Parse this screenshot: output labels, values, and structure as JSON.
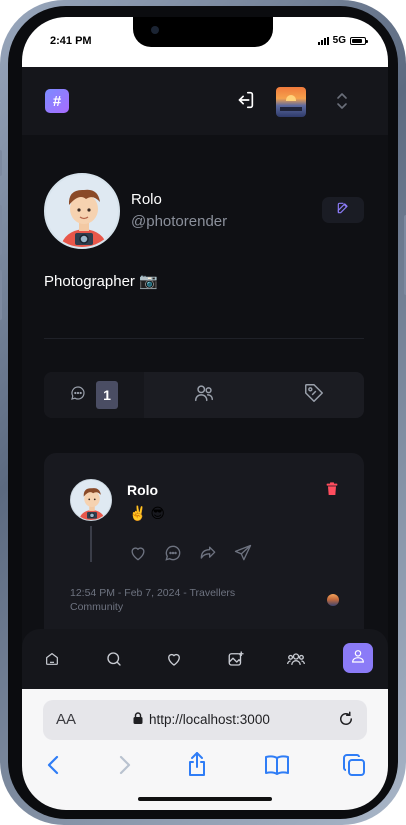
{
  "status_bar": {
    "time": "2:41 PM",
    "network": "5G"
  },
  "header": {
    "logo_symbol": "#",
    "logout_icon": "logout-icon",
    "thumbnail": "community-thumbnail",
    "switcher_icon": "chevron-up-down-icon"
  },
  "profile": {
    "name": "Rolo",
    "handle": "@photorender",
    "bio": "Photographer 📷",
    "edit_icon": "edit-icon"
  },
  "tabs": [
    {
      "icon": "chat-bubble-icon",
      "count": "1",
      "active": true
    },
    {
      "icon": "users-icon",
      "active": false
    },
    {
      "icon": "tag-icon",
      "active": false
    }
  ],
  "post": {
    "author": "Rolo",
    "text": "✌️ 😎",
    "meta": "12:54 PM - Feb 7, 2024 - Travellers Community",
    "actions": [
      "heart-icon",
      "comment-icon",
      "share-icon",
      "send-icon"
    ],
    "delete_icon": "trash-icon"
  },
  "bottom_nav": [
    "home-icon",
    "search-icon",
    "heart-icon",
    "image-plus-icon",
    "community-icon",
    "profile-icon"
  ],
  "browser": {
    "text_size_label": "AA",
    "url": "http://localhost:3000"
  },
  "colors": {
    "accent": "#8b7bf7",
    "danger": "#ff4d5e",
    "background": "#0f1014"
  }
}
